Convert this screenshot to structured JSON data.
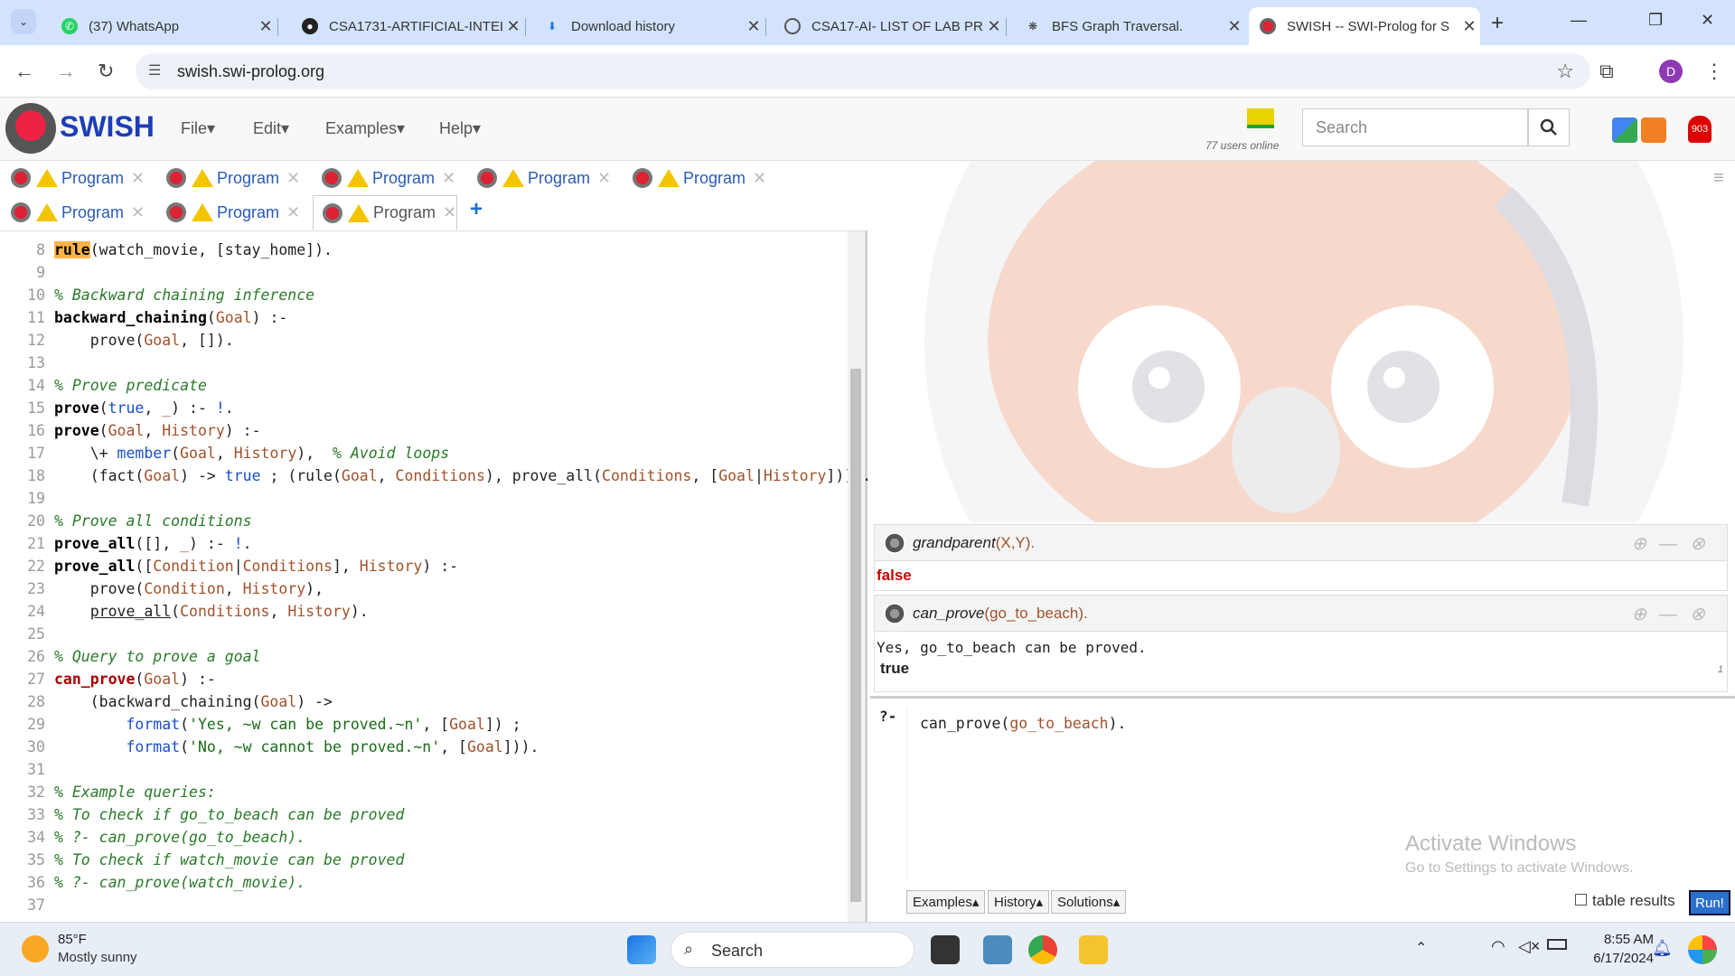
{
  "browser": {
    "tabs": [
      {
        "title": "(37) WhatsApp"
      },
      {
        "title": "CSA1731-ARTIFICIAL-INTEL"
      },
      {
        "title": "Download history"
      },
      {
        "title": "CSA17-AI- LIST OF LAB PR"
      },
      {
        "title": "BFS Graph Traversal."
      },
      {
        "title": "SWISH -- SWI-Prolog for S"
      }
    ],
    "url": "swish.swi-prolog.org",
    "profile_initial": "D"
  },
  "swish": {
    "brand": "SWISH",
    "menus": [
      "File",
      "Edit",
      "Examples",
      "Help"
    ],
    "users_online": "77 users online",
    "search_placeholder": "Search",
    "notification_count": "903",
    "tabs": [
      "Program",
      "Program",
      "Program",
      "Program",
      "Program",
      "Program",
      "Program",
      "Program"
    ]
  },
  "editor": {
    "lines": [
      {
        "n": "8",
        "html": "<span class='kw hl'>rule</span>(watch_movie, [stay_home])."
      },
      {
        "n": "9",
        "html": ""
      },
      {
        "n": "10",
        "html": "<span class='cmt'>% Backward chaining inference</span>"
      },
      {
        "n": "11",
        "html": "<span class='kw'>backward_chaining</span>(<span class='var'>Goal</span>) :-"
      },
      {
        "n": "12",
        "html": "    prove(<span class='var'>Goal</span>, [])."
      },
      {
        "n": "13",
        "html": ""
      },
      {
        "n": "14",
        "html": "<span class='cmt'>% Prove predicate</span>"
      },
      {
        "n": "15",
        "html": "<span class='kw'>prove</span>(<span class='blt'>true</span>, <span class='var'>_</span>) :- <span class='blt'>!</span>."
      },
      {
        "n": "16",
        "html": "<span class='kw'>prove</span>(<span class='var'>Goal</span>, <span class='var'>History</span>) :-"
      },
      {
        "n": "17",
        "html": "    \\+ <span class='blt'>member</span>(<span class='var'>Goal</span>, <span class='var'>History</span>),  <span class='cmt'>% Avoid loops</span>"
      },
      {
        "n": "18",
        "html": "    (fact(<span class='var'>Goal</span>) -> <span class='blt'>true</span> ; (rule(<span class='var'>Goal</span>, <span class='var'>Conditions</span>), prove_all(<span class='var'>Conditions</span>, [<span class='var'>Goal</span>|<span class='var'>History</span>])))."
      },
      {
        "n": "19",
        "html": ""
      },
      {
        "n": "20",
        "html": "<span class='cmt'>% Prove all conditions</span>"
      },
      {
        "n": "21",
        "html": "<span class='kw'>prove_all</span>([], <span class='var'>_</span>) :- <span class='blt'>!</span>."
      },
      {
        "n": "22",
        "html": "<span class='kw'>prove_all</span>([<span class='var'>Condition</span>|<span class='var'>Conditions</span>], <span class='var'>History</span>) :-"
      },
      {
        "n": "23",
        "html": "    prove(<span class='var'>Condition</span>, <span class='var'>History</span>),"
      },
      {
        "n": "24",
        "html": "    <u>prove_all</u>(<span class='var'>Conditions</span>, <span class='var'>History</span>)."
      },
      {
        "n": "25",
        "html": ""
      },
      {
        "n": "26",
        "html": "<span class='cmt'>% Query to prove a goal</span>"
      },
      {
        "n": "27",
        "html": "<span class='kw' style='color:#a00'>can_prove</span>(<span class='var'>Goal</span>) :-"
      },
      {
        "n": "28",
        "html": "    (backward_chaining(<span class='var'>Goal</span>) ->"
      },
      {
        "n": "29",
        "html": "        <span class='blt'>format</span>(<span class='str'>'Yes, ~w can be proved.~n'</span>, [<span class='var'>Goal</span>]) ;"
      },
      {
        "n": "30",
        "html": "        <span class='blt'>format</span>(<span class='str'>'No, ~w cannot be proved.~n'</span>, [<span class='var'>Goal</span>]))."
      },
      {
        "n": "31",
        "html": ""
      },
      {
        "n": "32",
        "html": "<span class='cmt'>% Example queries:</span>"
      },
      {
        "n": "33",
        "html": "<span class='cmt'>% To check if go_to_beach can be proved</span>"
      },
      {
        "n": "34",
        "html": "<span class='cmt'>% ?- can_prove(go_to_beach).</span>"
      },
      {
        "n": "35",
        "html": "<span class='cmt'>% To check if watch_movie can be proved</span>"
      },
      {
        "n": "36",
        "html": "<span class='cmt'>% ?- can_prove(watch_movie).</span>"
      },
      {
        "n": "37",
        "html": ""
      }
    ]
  },
  "results": [
    {
      "query_pred": "grandparent",
      "query_args": "(X,Y).",
      "output": "",
      "result": "false"
    },
    {
      "query_pred": "can_prove",
      "query_args": "(go_to_beach).",
      "output": "Yes, go_to_beach can be proved.",
      "result": "true",
      "count": "1"
    }
  ],
  "query": {
    "prompt": "?-",
    "text_pred": "can_prove(",
    "text_arg": "go_to_beach",
    "text_end": ").",
    "buttons": [
      "Examples▴",
      "History▴",
      "Solutions▴"
    ],
    "table_results_label": "table results",
    "run_label": "Run!"
  },
  "watermark": {
    "line1": "Activate Windows",
    "line2": "Go to Settings to activate Windows."
  },
  "taskbar": {
    "weather_temp": "85°F",
    "weather_desc": "Mostly sunny",
    "search_label": "Search",
    "time": "8:55 AM",
    "date": "6/17/2024"
  }
}
